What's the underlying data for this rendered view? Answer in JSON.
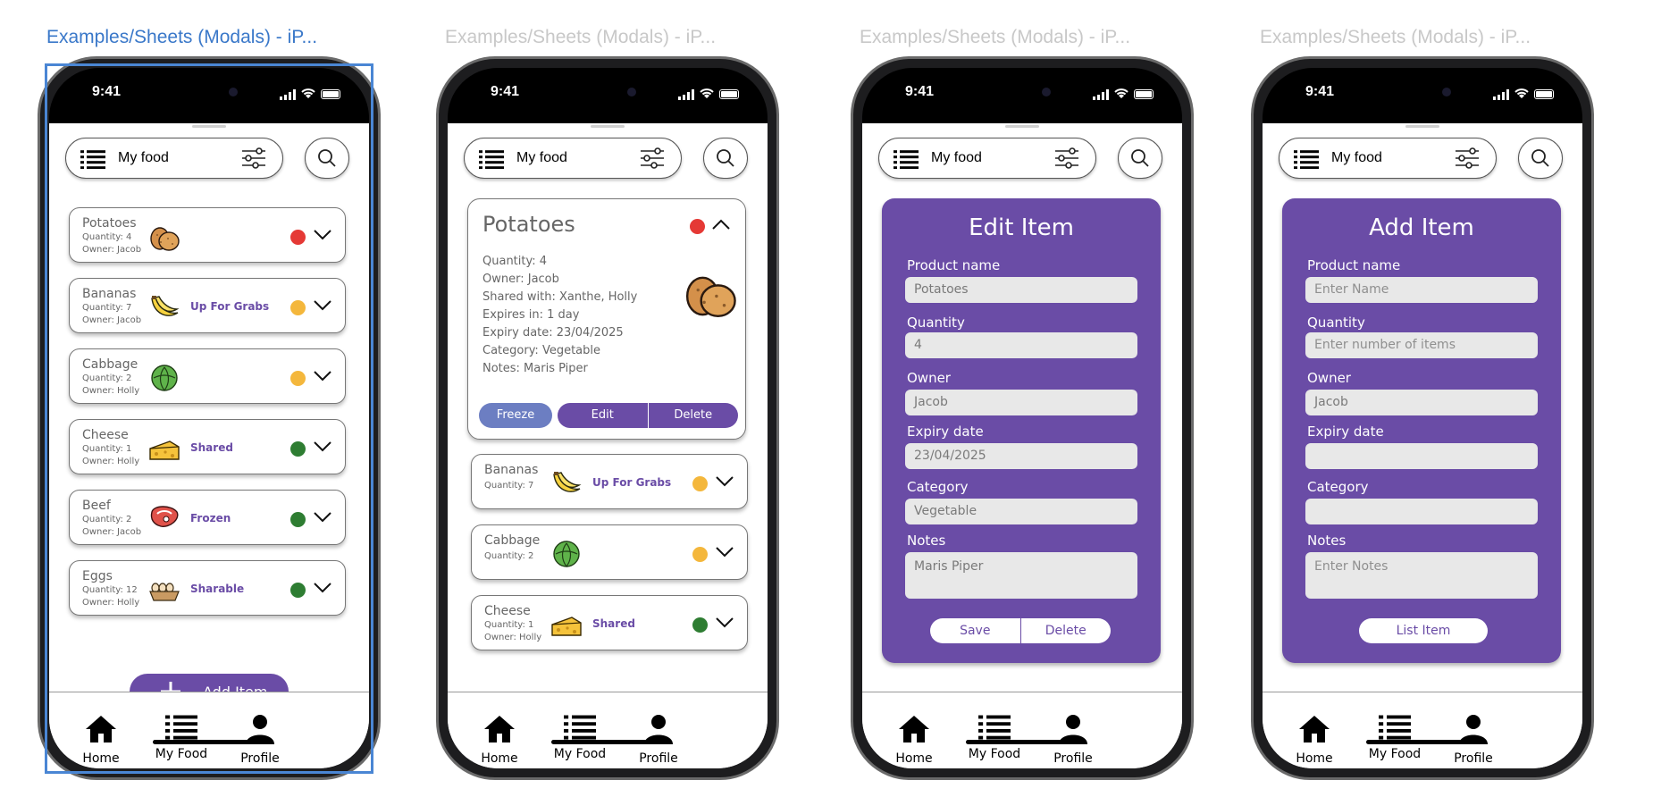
{
  "colors": {
    "accent": "#6a4ca6",
    "freeze": "#6c7ec2",
    "dot_red": "#e53935",
    "dot_amber": "#f4b73c",
    "dot_green": "#2e7d32",
    "selection": "#4a86d4"
  },
  "frames": [
    {
      "title": "Examples/Sheets (Modals) - iP...",
      "time": "9:41",
      "topbar": {
        "title": "My food",
        "menu_icon": "list-icon",
        "filter_icon": "sliders-icon",
        "search_icon": "search-icon"
      },
      "items": [
        {
          "name": "Potatoes",
          "qty": "Quantity: 4",
          "owner": "Owner: Jacob",
          "badge": "",
          "status": "red",
          "icon": "potato-icon"
        },
        {
          "name": "Bananas",
          "qty": "Quantity: 7",
          "owner": "Owner: Jacob",
          "badge": "Up For Grabs",
          "status": "amber",
          "icon": "banana-icon"
        },
        {
          "name": "Cabbage",
          "qty": "Quantity: 2",
          "owner": "Owner: Holly",
          "badge": "",
          "status": "amber",
          "icon": "cabbage-icon"
        },
        {
          "name": "Cheese",
          "qty": "Quantity: 1",
          "owner": "Owner: Holly",
          "badge": "Shared",
          "status": "green",
          "icon": "cheese-icon"
        },
        {
          "name": "Beef",
          "qty": "Quantity: 2",
          "owner": "Owner: Jacob",
          "badge": "Frozen",
          "status": "green",
          "icon": "steak-icon"
        },
        {
          "name": "Eggs",
          "qty": "Quantity: 12",
          "owner": "Owner: Holly",
          "badge": "Sharable",
          "status": "green",
          "icon": "eggs-icon"
        }
      ],
      "add_button": "Add Item",
      "tabs": [
        {
          "label": "Home",
          "icon": "home-icon"
        },
        {
          "label": "My Food",
          "icon": "list-icon"
        },
        {
          "label": "Profile",
          "icon": "person-icon"
        }
      ]
    },
    {
      "title": "Examples/Sheets (Modals) - iP...",
      "time": "9:41",
      "topbar": {
        "title": "My food"
      },
      "expanded": {
        "name": "Potatoes",
        "status": "red",
        "details": [
          "Quantity: 4",
          "Owner: Jacob",
          "Shared with: Xanthe, Holly",
          "Expires in: 1 day",
          "Expiry date: 23/04/2025",
          "Category: Vegetable",
          "Notes: Maris Piper"
        ],
        "buttons": {
          "freeze": "Freeze",
          "edit": "Edit",
          "delete": "Delete"
        }
      },
      "items": [
        {
          "name": "Bananas",
          "qty": "Quantity: 7",
          "owner": "",
          "badge": "Up For Grabs",
          "status": "amber",
          "icon": "banana-icon"
        },
        {
          "name": "Cabbage",
          "qty": "Quantity: 2",
          "owner": "",
          "badge": "",
          "status": "amber",
          "icon": "cabbage-icon"
        },
        {
          "name": "Cheese",
          "qty": "Quantity: 1",
          "owner": "Owner: Holly",
          "badge": "Shared",
          "status": "green",
          "icon": "cheese-icon"
        }
      ],
      "tabs": [
        {
          "label": "Home"
        },
        {
          "label": "My Food"
        },
        {
          "label": "Profile"
        }
      ]
    },
    {
      "title": "Examples/Sheets (Modals) - iP...",
      "time": "9:41",
      "topbar": {
        "title": "My food"
      },
      "modal": {
        "title": "Edit Item",
        "fields": [
          {
            "label": "Product name",
            "value": "Potatoes"
          },
          {
            "label": "Quantity",
            "value": "4"
          },
          {
            "label": "Owner",
            "value": "Jacob"
          },
          {
            "label": "Expiry date",
            "value": "23/04/2025"
          },
          {
            "label": "Category",
            "value": "Vegetable"
          },
          {
            "label": "Notes",
            "value": "Maris Piper"
          }
        ],
        "buttons": [
          "Save",
          "Delete"
        ]
      },
      "tabs": [
        {
          "label": "Home"
        },
        {
          "label": "My Food"
        },
        {
          "label": "Profile"
        }
      ]
    },
    {
      "title": "Examples/Sheets (Modals) - iP...",
      "time": "9:41",
      "topbar": {
        "title": "My food"
      },
      "modal": {
        "title": "Add Item",
        "fields": [
          {
            "label": "Product name",
            "placeholder": "Enter Name"
          },
          {
            "label": "Quantity",
            "placeholder": "Enter number of items"
          },
          {
            "label": "Owner",
            "value": "Jacob"
          },
          {
            "label": "Expiry date",
            "value": ""
          },
          {
            "label": "Category",
            "value": ""
          },
          {
            "label": "Notes",
            "placeholder": "Enter Notes"
          }
        ],
        "buttons": [
          "List Item"
        ]
      },
      "tabs": [
        {
          "label": "Home"
        },
        {
          "label": "My Food"
        },
        {
          "label": "Profile"
        }
      ]
    }
  ]
}
